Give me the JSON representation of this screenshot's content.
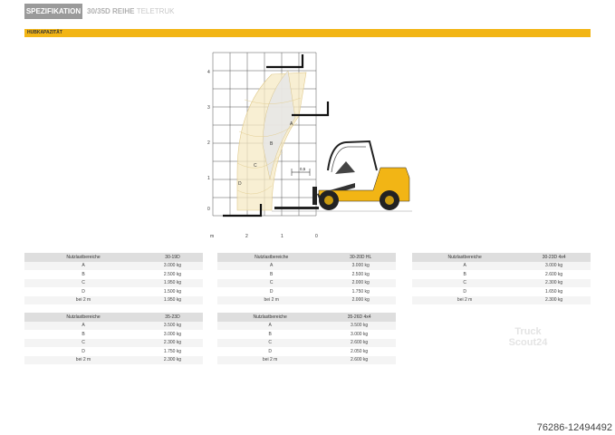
{
  "header": {
    "tab_label": "SPEZIFIKATION",
    "series_label": "30/35D REIHE",
    "series_sub": "TELETRUK"
  },
  "section_label": "HUBKAPAZITÄT",
  "diagram": {
    "y_ticks": [
      "4",
      "3",
      "2",
      "1",
      "0"
    ],
    "x_ticks": [
      "m",
      "2",
      "1",
      "0"
    ],
    "zone_labels": [
      "A",
      "B",
      "C",
      "D"
    ],
    "dimension_label": "0,5"
  },
  "tables": [
    {
      "headers": [
        "Nutzlastbereiche",
        "30-19D"
      ],
      "rows": [
        [
          "A",
          "3.000 kg"
        ],
        [
          "B",
          "2.500 kg"
        ],
        [
          "C",
          "1.950 kg"
        ],
        [
          "D",
          "1.500 kg"
        ],
        [
          "bei 2 m",
          "1.950 kg"
        ]
      ]
    },
    {
      "headers": [
        "Nutzlastbereiche",
        "30-20D HL"
      ],
      "rows": [
        [
          "A",
          "3.000 kg"
        ],
        [
          "B",
          "2.500 kg"
        ],
        [
          "C",
          "2.000 kg"
        ],
        [
          "D",
          "1.750 kg"
        ],
        [
          "bei 2 m",
          "2.000 kg"
        ]
      ]
    },
    {
      "headers": [
        "Nutzlastbereiche",
        "30-23D 4x4"
      ],
      "rows": [
        [
          "A",
          "3.000 kg"
        ],
        [
          "B",
          "2.600 kg"
        ],
        [
          "C",
          "2.300 kg"
        ],
        [
          "D",
          "1.650 kg"
        ],
        [
          "bei 2 m",
          "2.300 kg"
        ]
      ]
    },
    {
      "headers": [
        "Nutzlastbereiche",
        "35-23D"
      ],
      "rows": [
        [
          "A",
          "3.500 kg"
        ],
        [
          "B",
          "3.000 kg"
        ],
        [
          "C",
          "2.300 kg"
        ],
        [
          "D",
          "1.750 kg"
        ],
        [
          "bei 2 m",
          "2.300 kg"
        ]
      ]
    },
    {
      "headers": [
        "Nutzlastbereiche",
        "35-26D 4x4"
      ],
      "rows": [
        [
          "A",
          "3.500 kg"
        ],
        [
          "B",
          "3.000 kg"
        ],
        [
          "C",
          "2.600 kg"
        ],
        [
          "D",
          "2.050 kg"
        ],
        [
          "bei 2 m",
          "2.600 kg"
        ]
      ]
    }
  ],
  "watermark": [
    "Truck",
    "Scout24"
  ],
  "listing_id": "76286-12494492",
  "colors": {
    "accent": "#f2b515",
    "tab_bg": "#9a9a9a",
    "zone_outer": "#f5e6b8",
    "zone_inner": "#e8e8e8"
  }
}
